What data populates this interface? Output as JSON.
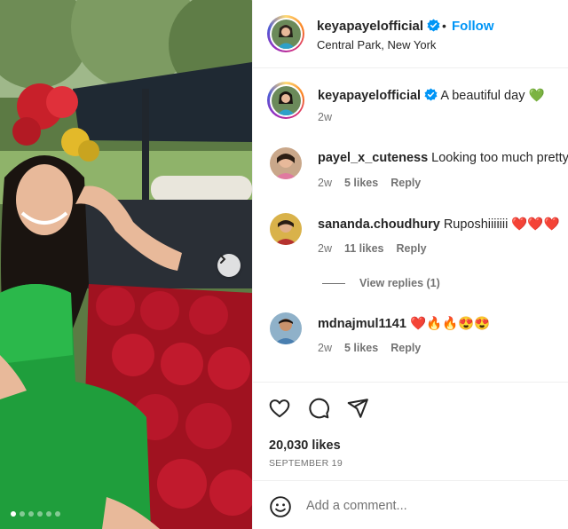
{
  "post": {
    "username": "keyapayelofficial",
    "location": "Central Park, New York",
    "follow_label": "Follow",
    "separator": "•"
  },
  "caption": {
    "username": "keyapayelofficial",
    "text": "A beautiful day 💚",
    "age": "2w"
  },
  "comments": [
    {
      "username": "payel_x_cuteness",
      "text": "Looking too much pretty",
      "age": "2w",
      "likes": "5 likes",
      "reply": "Reply"
    },
    {
      "username": "sananda.choudhury",
      "text": "Ruposhiiiiiii ❤️❤️❤️",
      "age": "2w",
      "likes": "11 likes",
      "reply": "Reply"
    },
    {
      "username": "mdnajmul1141",
      "text": "❤️🔥🔥😍😍",
      "age": "2w",
      "likes": "5 likes",
      "reply": "Reply"
    }
  ],
  "view_replies": "View replies (1)",
  "actions": {
    "like_icon": "heart-icon",
    "comment_icon": "comment-icon",
    "share_icon": "share-icon"
  },
  "stats": {
    "likes": "20,030 likes",
    "date": "SEPTEMBER 19"
  },
  "add_comment": {
    "placeholder": "Add a comment..."
  },
  "carousel": {
    "slides": 6,
    "active": 1
  },
  "colors": {
    "follow": "#0095f6",
    "verified": "#0095f6",
    "text": "#262626",
    "muted": "#737373"
  }
}
